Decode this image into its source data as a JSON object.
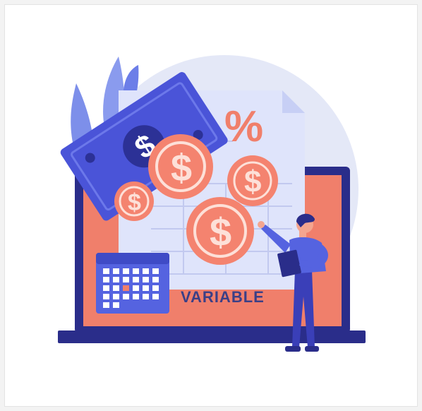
{
  "illustration": {
    "label": "VARIABLE",
    "percent_symbol": "%",
    "currency_symbol": "$"
  },
  "colors": {
    "background_circle": "#e4e8f7",
    "laptop_dark": "#2a2d8a",
    "laptop_screen": "#f07f6b",
    "document": "#dfe4fb",
    "coin_fill": "#f4836f",
    "coin_ring": "#fde0d8",
    "banknote": "#4a54d8",
    "leaves": "#6c7ee8",
    "calendar_blue": "#5563e0",
    "calendar_highlight": "#f07f6b",
    "text_navy": "#3b3f86",
    "person_shirt": "#5563e0",
    "person_pants": "#3a3fb8"
  }
}
